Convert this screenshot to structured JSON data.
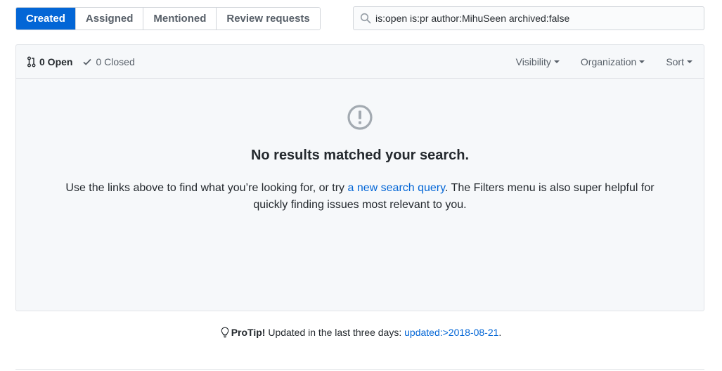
{
  "tabs": [
    {
      "label": "Created",
      "selected": true
    },
    {
      "label": "Assigned"
    },
    {
      "label": "Mentioned"
    },
    {
      "label": "Review requests"
    }
  ],
  "search": {
    "value": "is:open is:pr author:MihuSeen archived:false",
    "icon": "search-icon"
  },
  "header": {
    "open": "0 Open",
    "closed": "0 Closed",
    "filters": [
      "Visibility",
      "Organization",
      "Sort"
    ]
  },
  "blankslate": {
    "icon": "alert-icon",
    "title": "No results matched your search.",
    "text_before": "Use the links above to find what you’re looking for, or try ",
    "link": "a new search query",
    "text_after": ". The Filters menu is also super helpful for quickly finding issues most relevant to you."
  },
  "protip": {
    "label": "ProTip!",
    "text": " Updated in the last three days: ",
    "link": "updated:>2018-08-21",
    "end": "."
  },
  "colors": {
    "accent": "#0366d6",
    "muted": "#586069",
    "border": "#e1e4e8",
    "panel": "#f6f8fa"
  }
}
